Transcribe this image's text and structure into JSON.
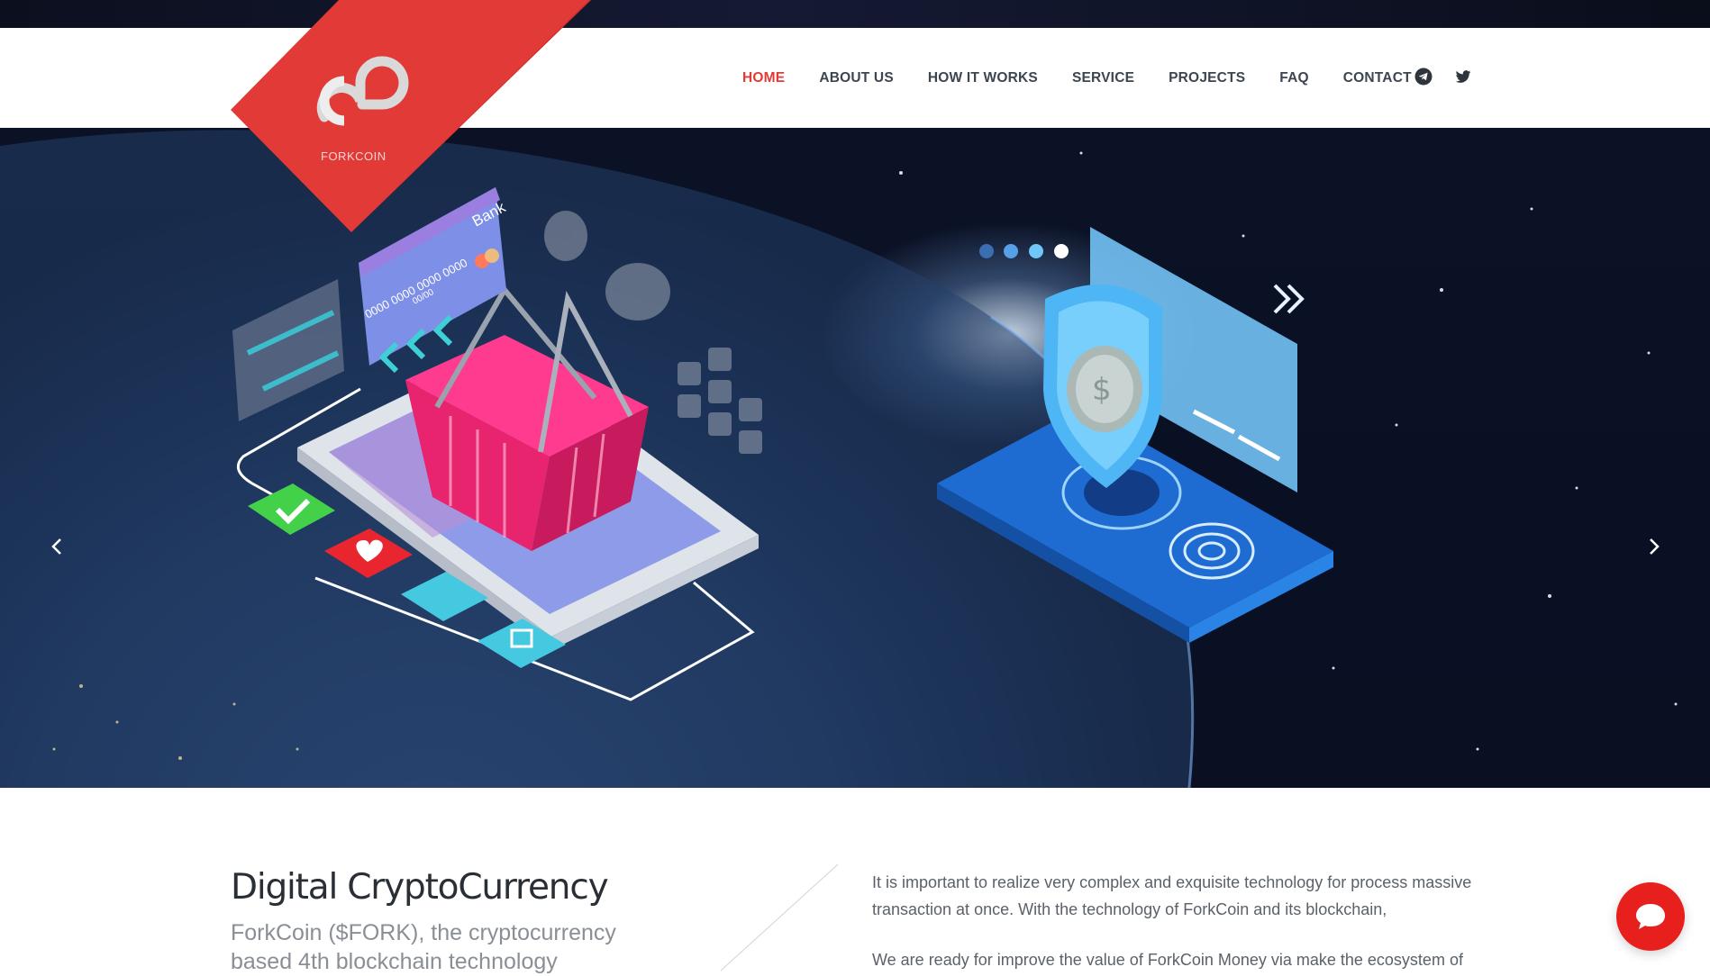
{
  "brand": {
    "name": "FORKCOIN",
    "color": "#e23a36"
  },
  "nav": {
    "items": [
      {
        "label": "HOME",
        "active": true
      },
      {
        "label": "ABOUT US",
        "active": false
      },
      {
        "label": "HOW IT WORKS",
        "active": false
      },
      {
        "label": "SERVICE",
        "active": false
      },
      {
        "label": "PROJECTS",
        "active": false
      },
      {
        "label": "FAQ",
        "active": false
      },
      {
        "label": "CONTACT",
        "active": false
      }
    ],
    "social": [
      "telegram-icon",
      "twitter-icon"
    ]
  },
  "hero": {
    "card_label": "Bank",
    "card_number": "0000 0000 0000 0000",
    "card_expiry": "00/00",
    "arrows": [
      "chevron-left-icon",
      "chevron-right-icon"
    ]
  },
  "content": {
    "heading": "Digital CryptoCurrency",
    "subheading": "ForkCoin ($FORK), the cryptocurrency based 4th blockchain technology",
    "paragraph1": "It is important to realize very complex and exquisite technology for process massive transaction at once. With the technology of ForkCoin and its blockchain,",
    "paragraph2": "We are ready for improve the value of ForkCoin Money via make the ecosystem of"
  },
  "chat": {
    "icon": "chat-bubble-icon",
    "color": "#e8201d"
  }
}
